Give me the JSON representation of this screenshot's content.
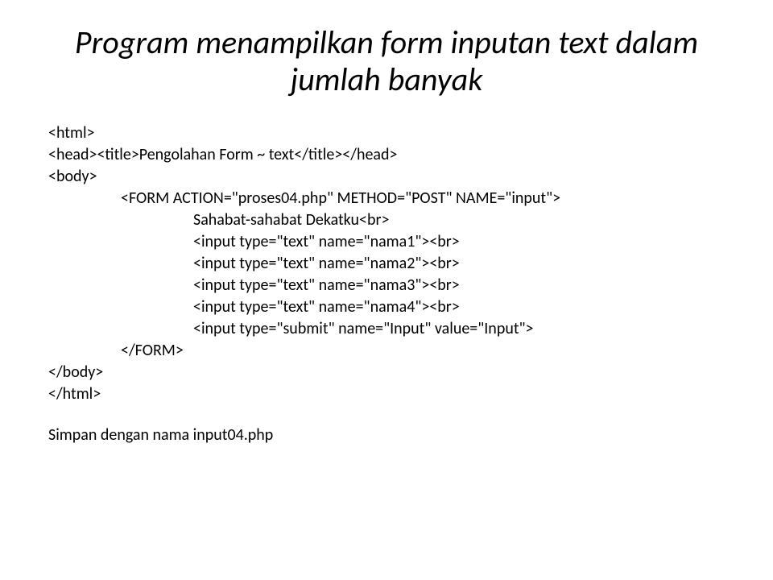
{
  "title": "Program menampilkan form inputan text dalam jumlah banyak",
  "code": {
    "l1": "<html>",
    "l2": "<head><title>Pengolahan Form ~ text</title></head>",
    "l3": "<body>",
    "l4": "<FORM ACTION=\"proses04.php\" METHOD=\"POST\" NAME=\"input\">",
    "l5": "Sahabat-sahabat Dekatku<br>",
    "l6": "<input type=\"text\" name=\"nama1\"><br>",
    "l7": "<input type=\"text\" name=\"nama2\"><br>",
    "l8": "<input type=\"text\" name=\"nama3\"><br>",
    "l9": "<input type=\"text\" name=\"nama4\"><br>",
    "l10": "<input type=\"submit\" name=\"Input\" value=\"Input\">",
    "l11": "</FORM>",
    "l12": "</body>",
    "l13": "</html>"
  },
  "footer": "Simpan dengan nama input04.php"
}
